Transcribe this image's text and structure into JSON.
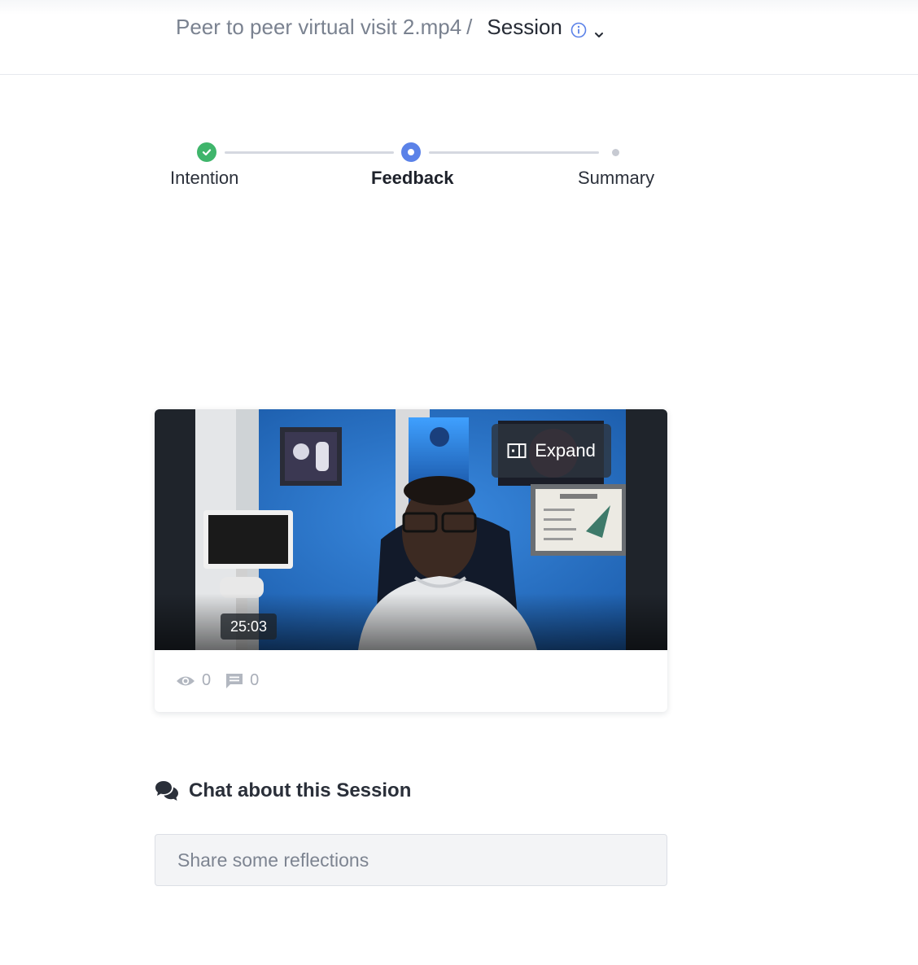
{
  "header": {
    "file_name": "Peer to peer virtual visit 2.mp4",
    "separator": "/",
    "session_label": "Session",
    "icons": [
      "info-icon",
      "chevron-down-icon"
    ]
  },
  "stepper": {
    "steps": [
      {
        "label": "Intention",
        "state": "complete"
      },
      {
        "label": "Feedback",
        "state": "active"
      },
      {
        "label": "Summary",
        "state": "upcoming"
      }
    ]
  },
  "video": {
    "expand_label": "Expand",
    "duration": "25:03",
    "views": "0",
    "comments": "0",
    "icons": [
      "expand-icon",
      "eye-icon",
      "comment-icon"
    ]
  },
  "chat": {
    "title": "Chat about this Session",
    "placeholder": "Share some reflections",
    "icon": "chat-bubbles-icon"
  },
  "colors": {
    "complete": "#3fb56b",
    "active": "#5b82e8",
    "upcoming": "#c7cad2",
    "line": "#d5d8e0"
  }
}
